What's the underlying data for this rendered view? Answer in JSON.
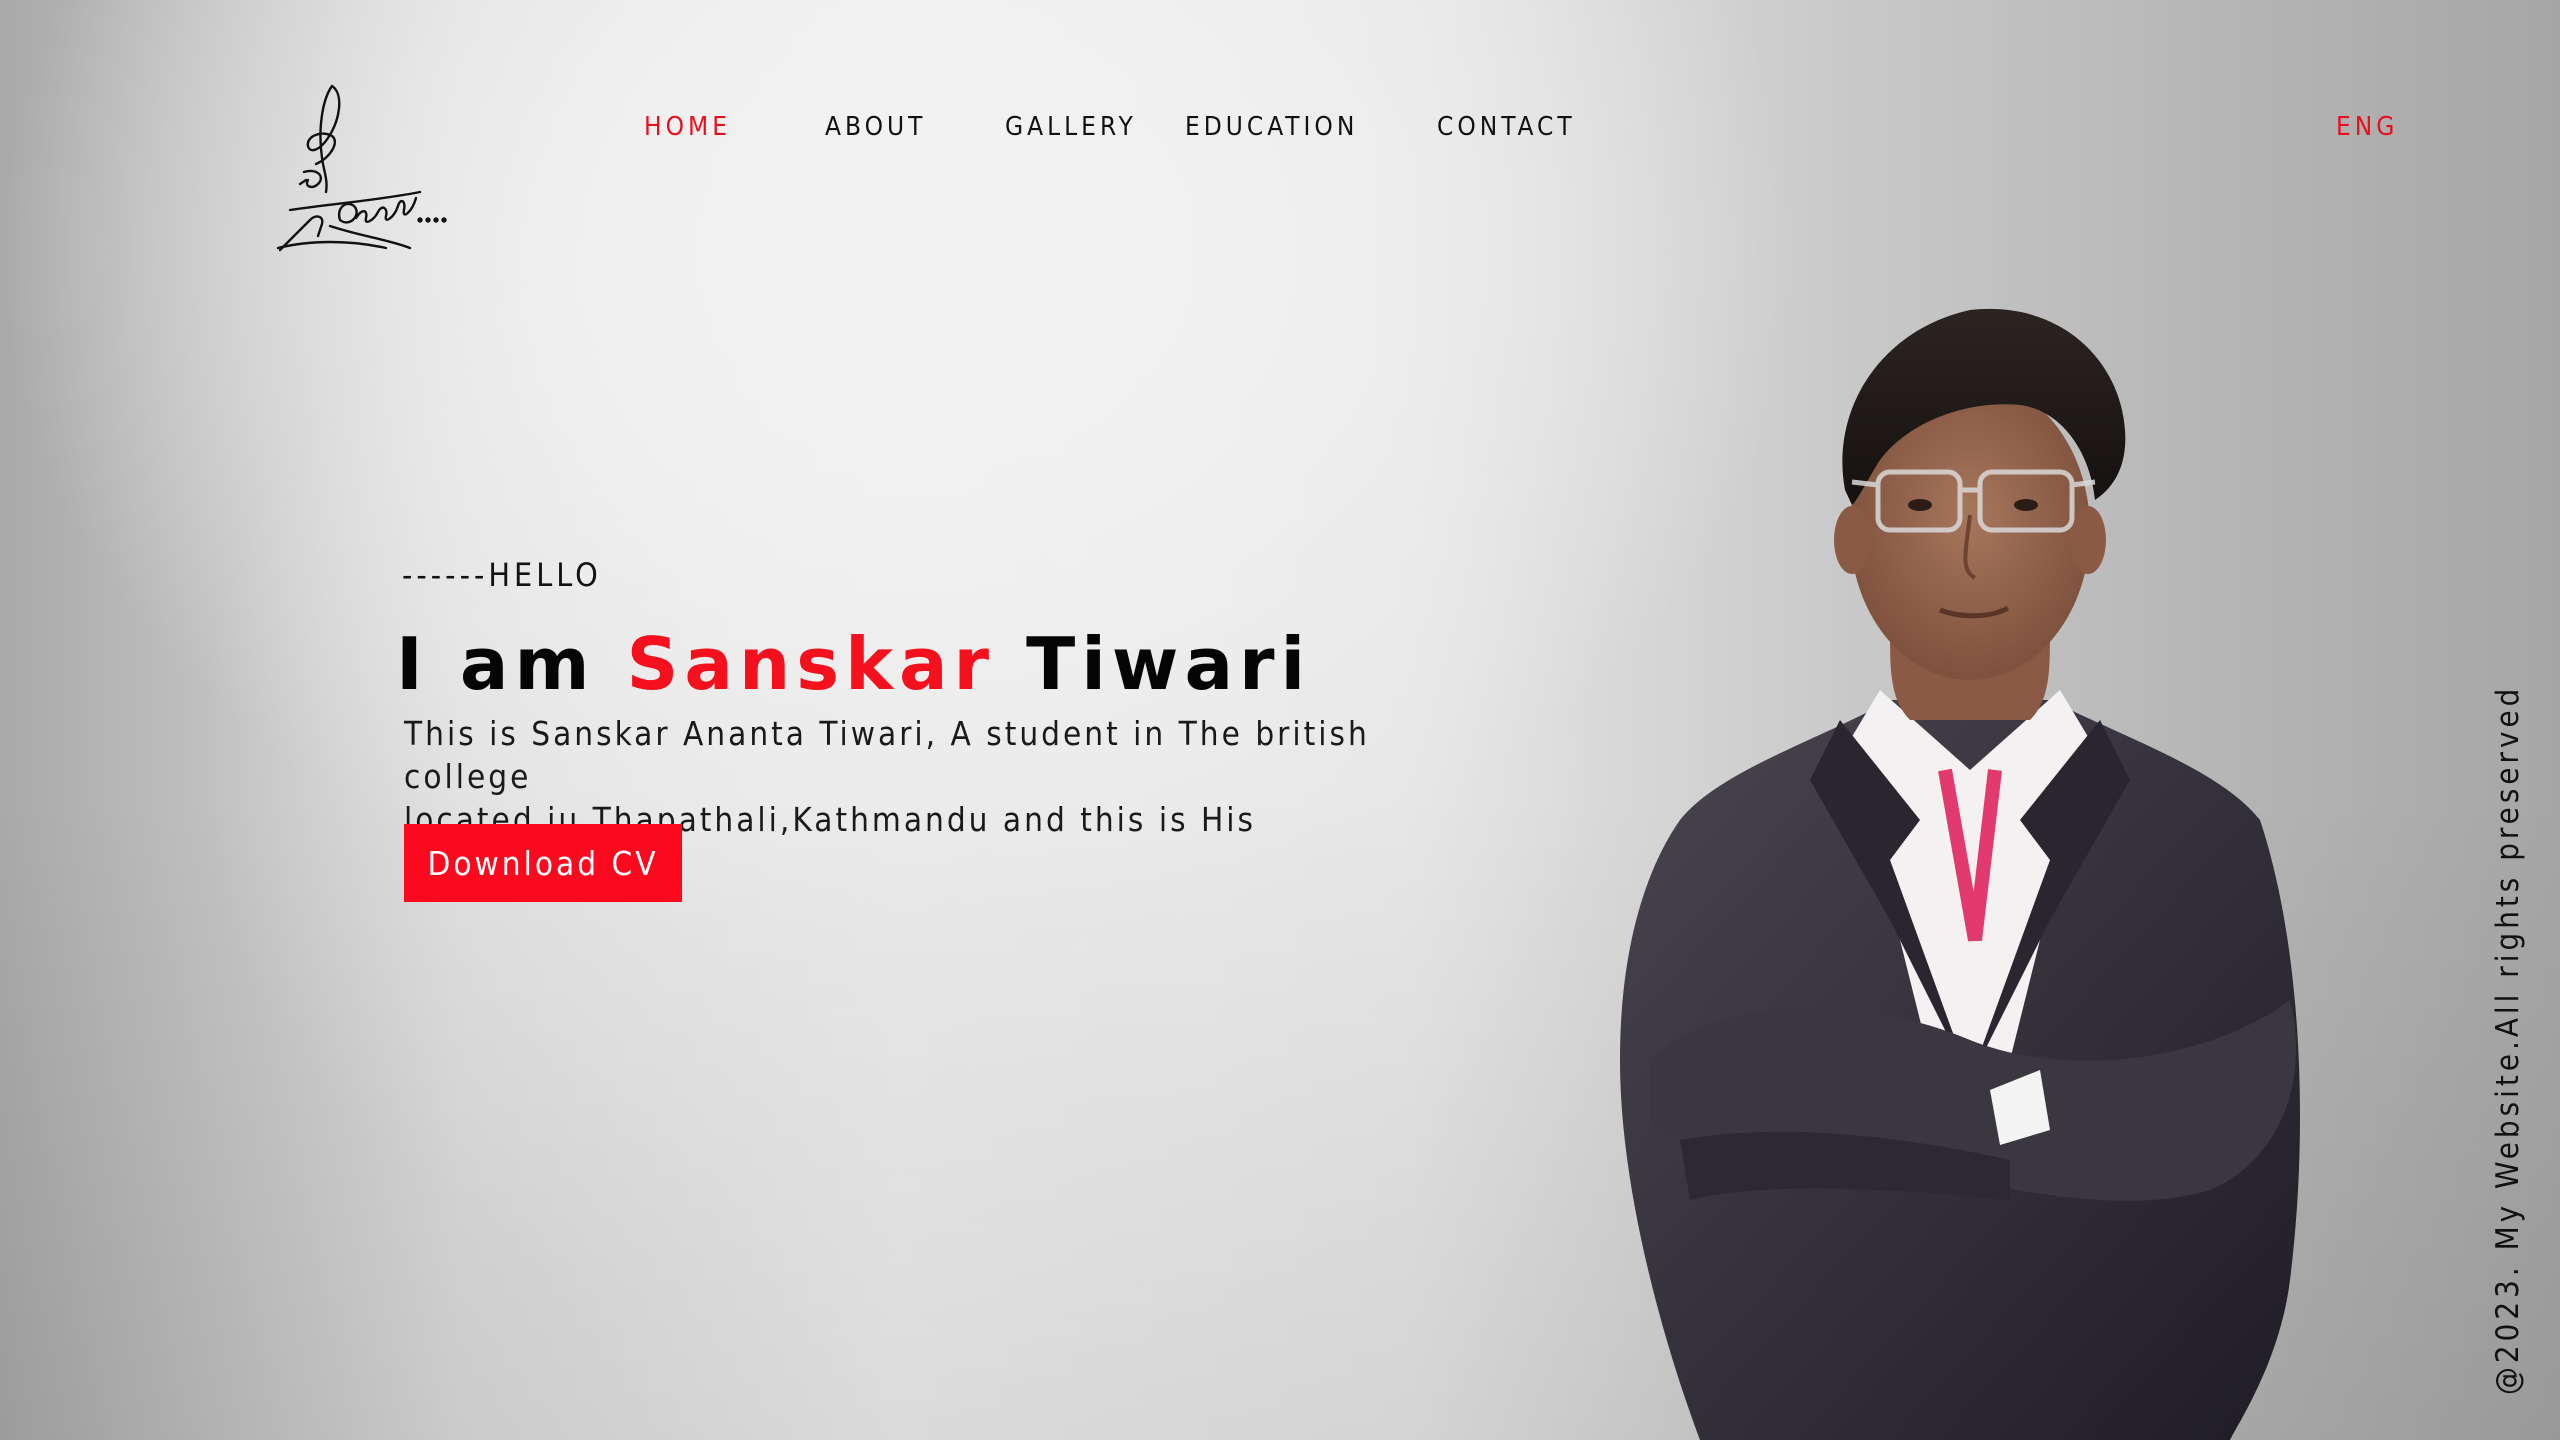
{
  "nav": {
    "items": [
      {
        "label": "HOME",
        "active": true
      },
      {
        "label": "ABOUT",
        "active": false
      },
      {
        "label": "GALLERY",
        "active": false
      },
      {
        "label": "EDUCATION",
        "active": false
      },
      {
        "label": "CONTACT",
        "active": false
      }
    ],
    "language": "ENG"
  },
  "hero": {
    "greeting": "------HELLO",
    "headline_prefix": "I am ",
    "headline_highlight": "Sanskar",
    "headline_suffix": " Tiwari",
    "description_line1": "This is Sanskar Ananta Tiwari, A student in The british college",
    "description_line2": "located iu Thapathali,Kathmandu and this is His project",
    "cta_label": "Download CV"
  },
  "footer": {
    "copyright": "@2023. My Website.All rights preserved"
  },
  "colors": {
    "accent": "#f4101c",
    "button": "#fb0a1f",
    "text": "#111111"
  },
  "icons": {
    "logo": "signature-logo",
    "portrait": "portrait-photo"
  }
}
